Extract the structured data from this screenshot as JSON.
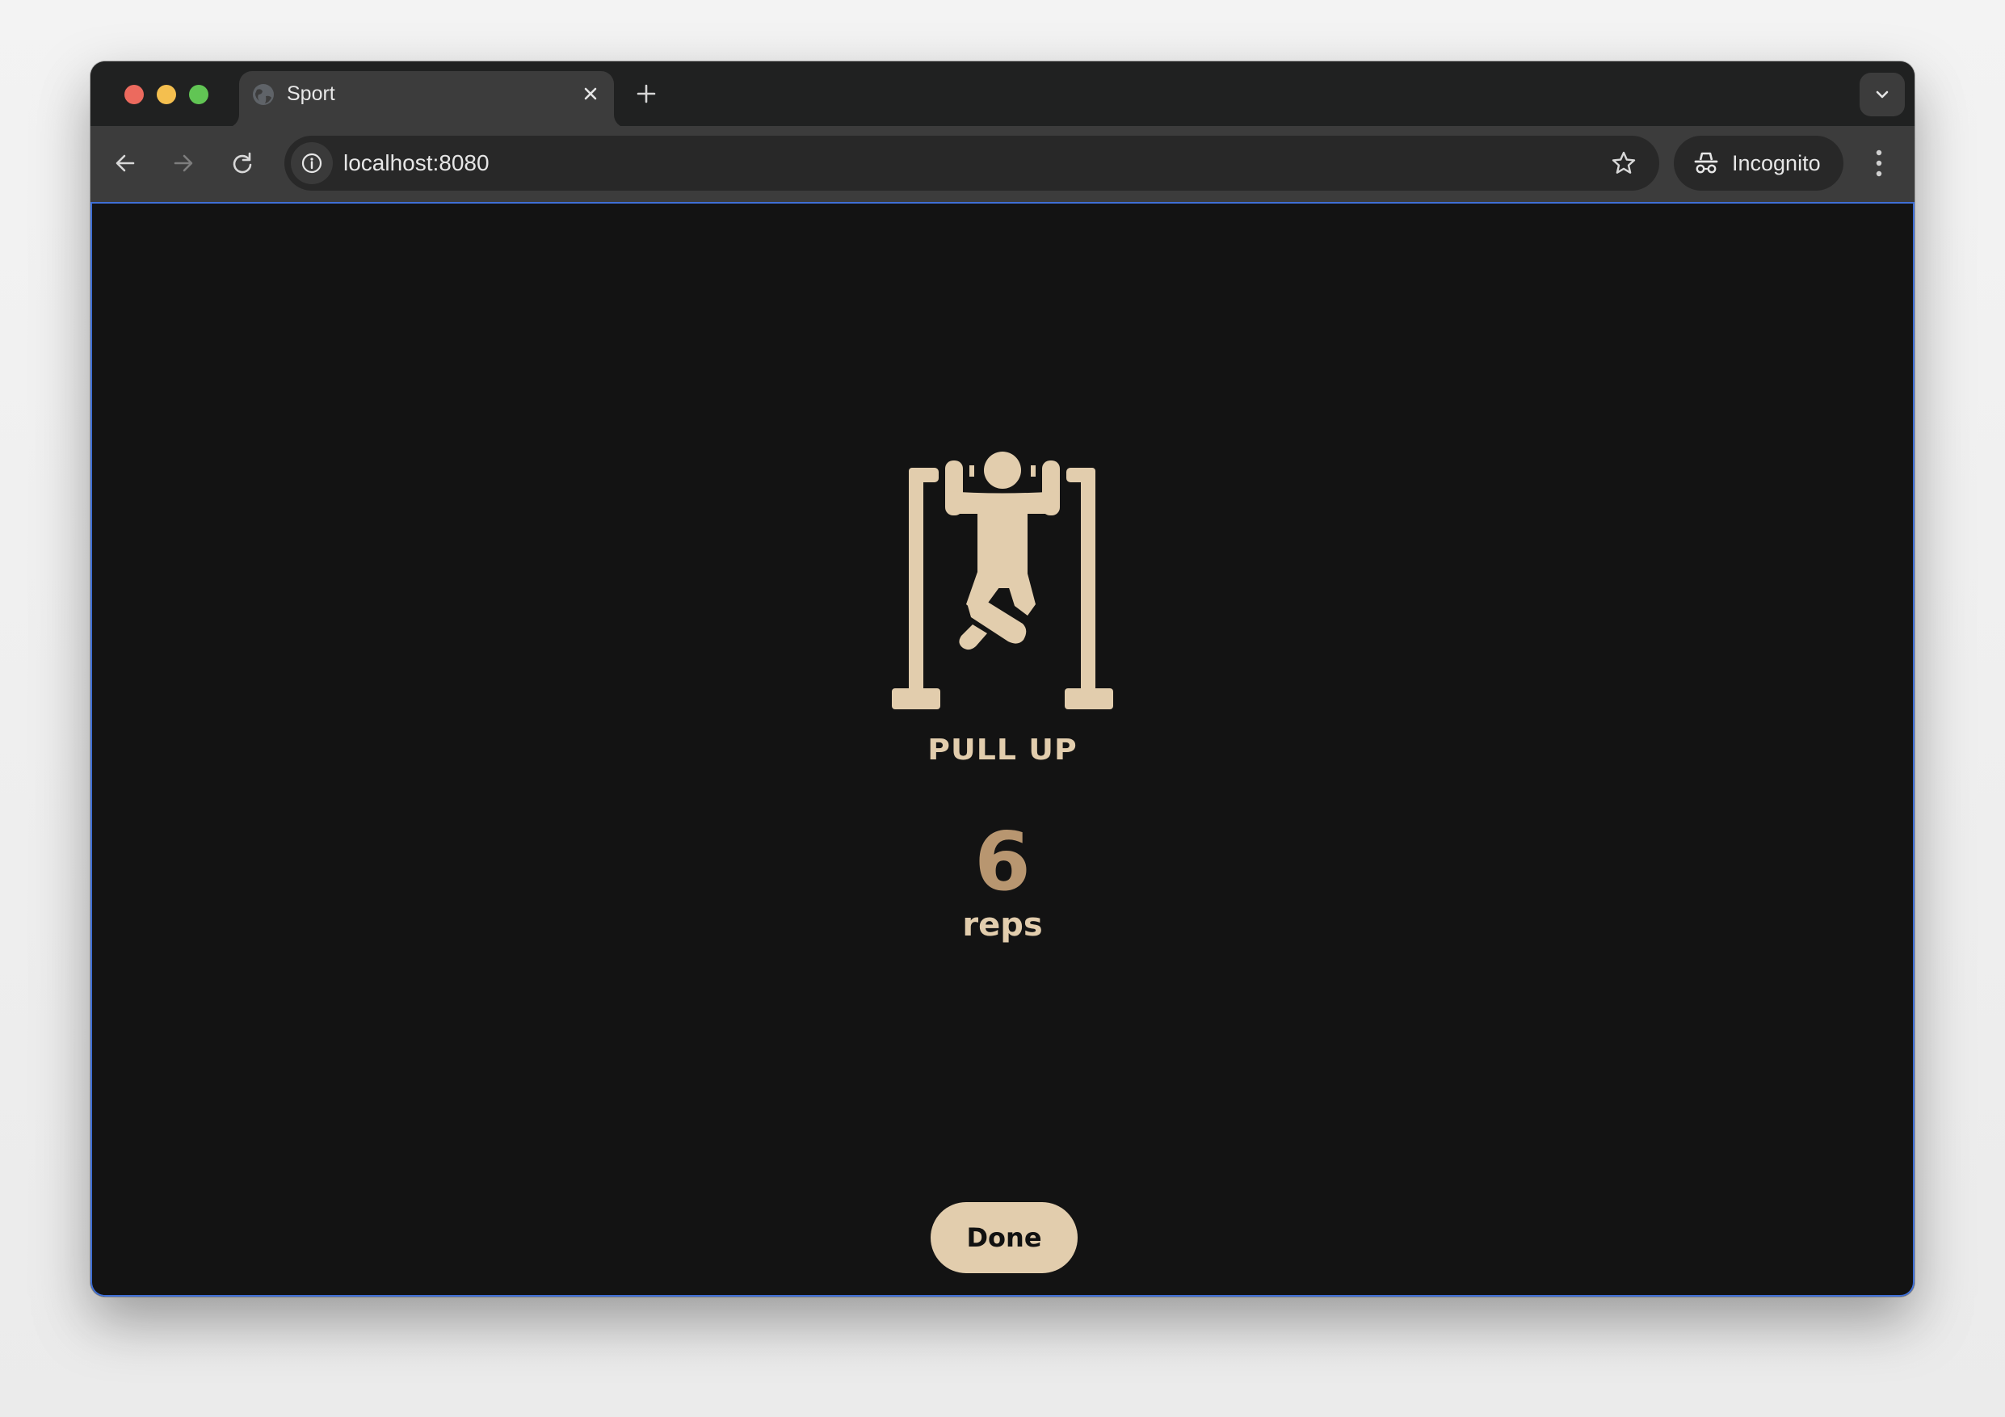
{
  "browser": {
    "traffic_lights": [
      "close",
      "minimize",
      "maximize"
    ],
    "tabs": [
      {
        "title": "Sport",
        "icon": "globe-icon",
        "active": true
      }
    ],
    "new_tab_icon": "plus-icon",
    "tab_menu_icon": "chevron-down-icon",
    "nav": {
      "back_icon": "arrow-left-icon",
      "forward_icon": "arrow-right-icon",
      "reload_icon": "reload-icon"
    },
    "address_bar": {
      "url": "localhost:8080",
      "site_info_icon": "info-icon",
      "bookmark_icon": "star-icon"
    },
    "profile": {
      "label": "Incognito",
      "icon": "incognito-icon"
    },
    "menu_icon": "kebab-menu-icon"
  },
  "page": {
    "exercise": {
      "icon": "pull-up-icon",
      "name": "PULL UP",
      "reps": "6",
      "unit": "reps"
    },
    "done_label": "Done",
    "colors": {
      "background": "#131313",
      "accent_light": "#e2cdad",
      "accent_dark": "#b89670",
      "button_text": "#111111"
    }
  }
}
